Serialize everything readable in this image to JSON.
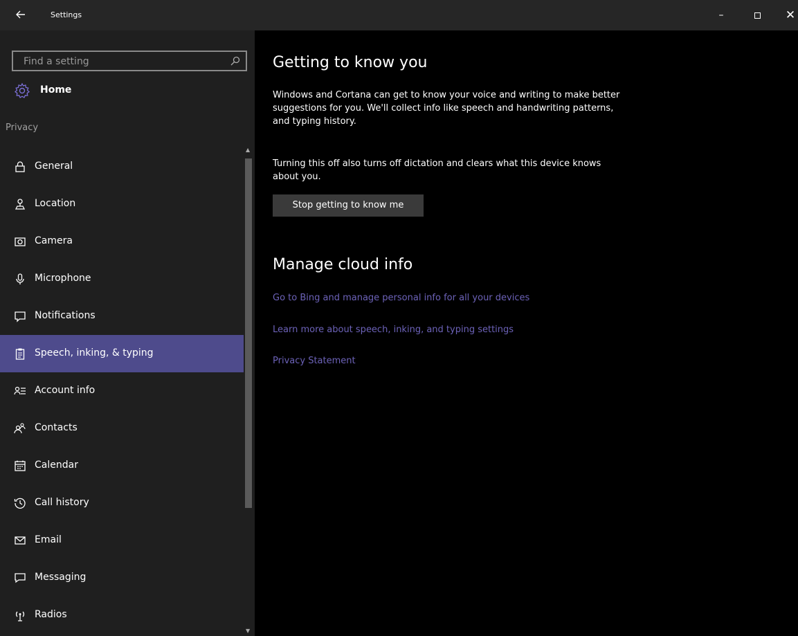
{
  "window": {
    "title": "Settings",
    "minimize": "–",
    "close": "✕"
  },
  "sidebar": {
    "search_placeholder": "Find a setting",
    "home_label": "Home",
    "section": "Privacy",
    "items": [
      {
        "label": "General",
        "icon": "lock-icon"
      },
      {
        "label": "Location",
        "icon": "location-icon"
      },
      {
        "label": "Camera",
        "icon": "camera-icon"
      },
      {
        "label": "Microphone",
        "icon": "microphone-icon"
      },
      {
        "label": "Notifications",
        "icon": "notifications-icon"
      },
      {
        "label": "Speech, inking, & typing",
        "icon": "clipboard-icon",
        "active": true
      },
      {
        "label": "Account info",
        "icon": "account-info-icon"
      },
      {
        "label": "Contacts",
        "icon": "contacts-icon"
      },
      {
        "label": "Calendar",
        "icon": "calendar-icon"
      },
      {
        "label": "Call history",
        "icon": "call-history-icon"
      },
      {
        "label": "Email",
        "icon": "email-icon"
      },
      {
        "label": "Messaging",
        "icon": "messaging-icon"
      },
      {
        "label": "Radios",
        "icon": "radios-icon"
      }
    ]
  },
  "main": {
    "heading1": "Getting to know you",
    "paragraph1": "Windows and Cortana can get to know your voice and writing to make better suggestions for you. We'll collect info like speech and handwriting patterns, and typing history.",
    "paragraph2": "Turning this off also turns off dictation and clears what this device knows about you.",
    "button_label": "Stop getting to know me",
    "heading2": "Manage cloud info",
    "links": [
      "Go to Bing and manage personal info for all your devices",
      "Learn more about speech, inking, and typing settings",
      "Privacy Statement"
    ]
  },
  "colors": {
    "accent": "#4e4b8c",
    "link": "#6c62b8",
    "sidebar_bg": "#1f1f1f",
    "main_bg": "#000000",
    "titlebar_bg": "#262626"
  }
}
